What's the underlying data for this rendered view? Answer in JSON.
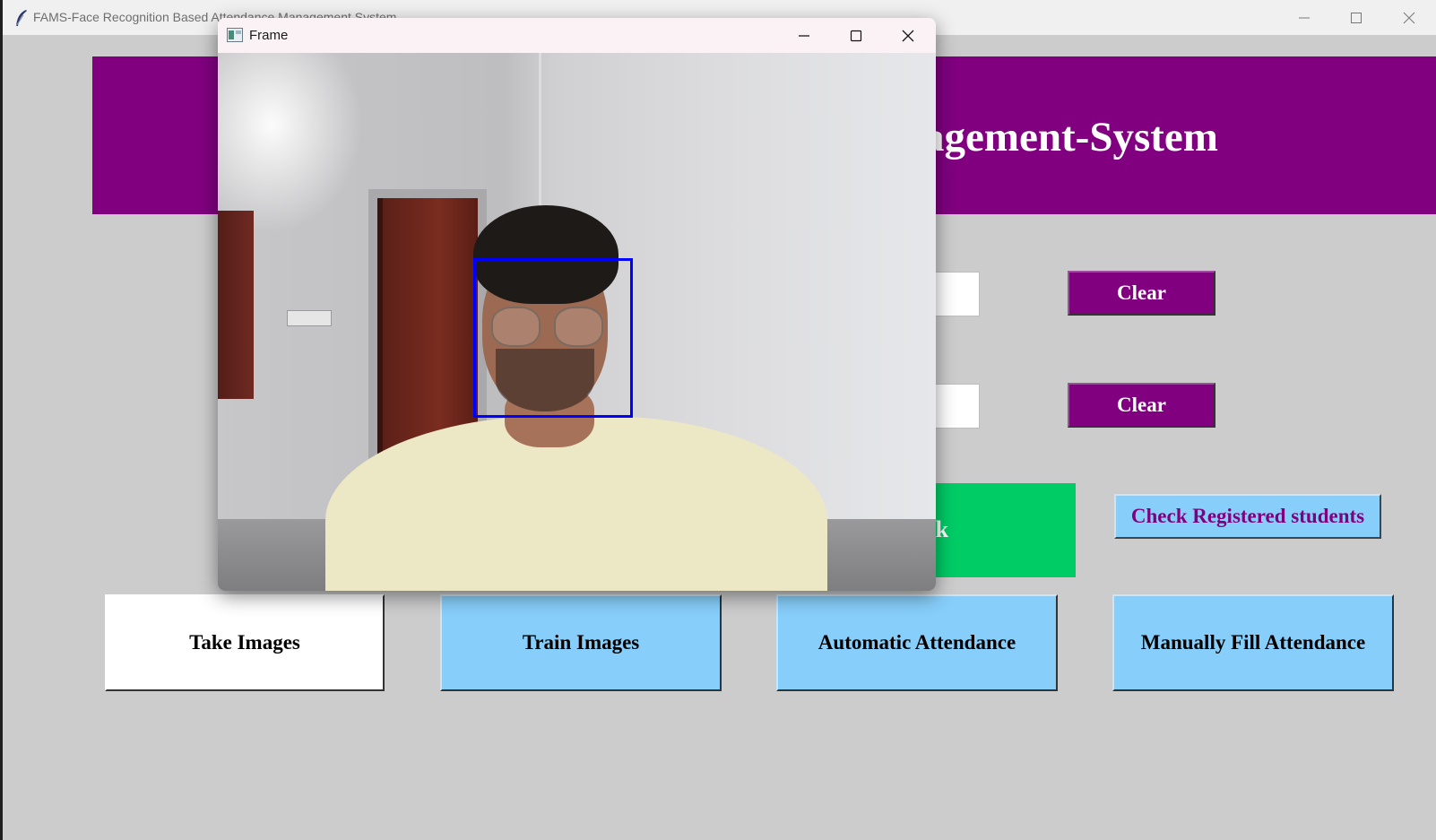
{
  "main_window": {
    "title": "FAMS-Face Recognition Based Attendance Management System",
    "banner_text": "Management-System",
    "clear_button_1": "Clear",
    "clear_button_2": "Clear",
    "notification_text": "dik",
    "check_registered_label": "Check Registered students",
    "buttons": {
      "take_images": "Take Images",
      "train_images": "Train Images",
      "automatic_attendance": "Automatic Attendance",
      "manually_fill": "Manually Fill Attendance"
    },
    "colors": {
      "banner": "#800080",
      "background": "#cccccc",
      "button": "#87cefa",
      "notification": "#00cc66",
      "detection_box": "#0000ff"
    }
  },
  "frame_window": {
    "title": "Frame"
  },
  "icons": {
    "app": "feather-icon",
    "frame": "window-app-icon",
    "minimize": "minimize-icon",
    "maximize": "maximize-icon",
    "close": "close-icon"
  }
}
